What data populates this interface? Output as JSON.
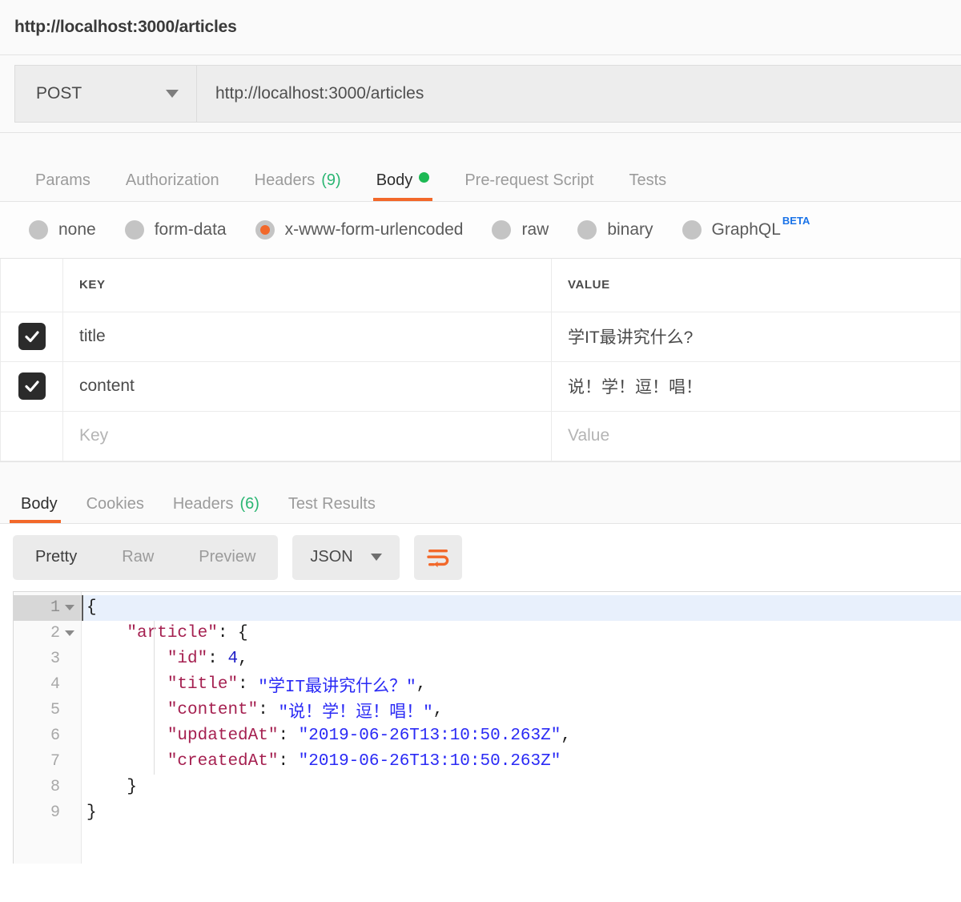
{
  "header": {
    "title": "http://localhost:3000/articles"
  },
  "request": {
    "method": "POST",
    "url": "http://localhost:3000/articles",
    "tabs": [
      {
        "label": "Params",
        "count": "",
        "active": false
      },
      {
        "label": "Authorization",
        "count": "",
        "active": false
      },
      {
        "label": "Headers",
        "count": "(9)",
        "active": false
      },
      {
        "label": "Body",
        "count": "",
        "active": true
      },
      {
        "label": "Pre-request Script",
        "count": "",
        "active": false
      },
      {
        "label": "Tests",
        "count": "",
        "active": false
      }
    ],
    "body_types": [
      {
        "label": "none",
        "checked": false
      },
      {
        "label": "form-data",
        "checked": false
      },
      {
        "label": "x-www-form-urlencoded",
        "checked": true
      },
      {
        "label": "raw",
        "checked": false
      },
      {
        "label": "binary",
        "checked": false
      },
      {
        "label": "GraphQL",
        "checked": false,
        "badge": "BETA"
      }
    ],
    "table": {
      "headers": {
        "key": "KEY",
        "value": "VALUE"
      },
      "rows": [
        {
          "checked": true,
          "key": "title",
          "value": "学IT最讲究什么?"
        },
        {
          "checked": true,
          "key": "content",
          "value": "说！学！逗！唱！"
        }
      ],
      "new_row": {
        "key_placeholder": "Key",
        "value_placeholder": "Value"
      }
    }
  },
  "response": {
    "tabs": [
      {
        "label": "Body",
        "count": "",
        "active": true
      },
      {
        "label": "Cookies",
        "count": "",
        "active": false
      },
      {
        "label": "Headers",
        "count": "(6)",
        "active": false
      },
      {
        "label": "Test Results",
        "count": "",
        "active": false
      }
    ],
    "view_modes": [
      {
        "label": "Pretty",
        "active": true
      },
      {
        "label": "Raw",
        "active": false
      },
      {
        "label": "Preview",
        "active": false
      }
    ],
    "format": "JSON",
    "wrap_icon": "word-wrap-icon",
    "code": {
      "lines": [
        {
          "num": "1",
          "fold": true,
          "highlight": true,
          "tokens": [
            {
              "t": "{",
              "c": "p"
            }
          ]
        },
        {
          "num": "2",
          "fold": true,
          "highlight": false,
          "tokens": [
            {
              "t": "    ",
              "c": "p"
            },
            {
              "t": "\"article\"",
              "c": "k"
            },
            {
              "t": ": {",
              "c": "p"
            }
          ]
        },
        {
          "num": "3",
          "fold": false,
          "highlight": false,
          "tokens": [
            {
              "t": "        ",
              "c": "p"
            },
            {
              "t": "\"id\"",
              "c": "k"
            },
            {
              "t": ": ",
              "c": "p"
            },
            {
              "t": "4",
              "c": "n"
            },
            {
              "t": ",",
              "c": "p"
            }
          ]
        },
        {
          "num": "4",
          "fold": false,
          "highlight": false,
          "tokens": [
            {
              "t": "        ",
              "c": "p"
            },
            {
              "t": "\"title\"",
              "c": "k"
            },
            {
              "t": ": ",
              "c": "p"
            },
            {
              "t": "\"学IT最讲究什么？\"",
              "c": "s"
            },
            {
              "t": ",",
              "c": "p"
            }
          ]
        },
        {
          "num": "5",
          "fold": false,
          "highlight": false,
          "tokens": [
            {
              "t": "        ",
              "c": "p"
            },
            {
              "t": "\"content\"",
              "c": "k"
            },
            {
              "t": ": ",
              "c": "p"
            },
            {
              "t": "\"说！学！逗！唱！\"",
              "c": "s"
            },
            {
              "t": ",",
              "c": "p"
            }
          ]
        },
        {
          "num": "6",
          "fold": false,
          "highlight": false,
          "tokens": [
            {
              "t": "        ",
              "c": "p"
            },
            {
              "t": "\"updatedAt\"",
              "c": "k"
            },
            {
              "t": ": ",
              "c": "p"
            },
            {
              "t": "\"2019-06-26T13:10:50.263Z\"",
              "c": "s"
            },
            {
              "t": ",",
              "c": "p"
            }
          ]
        },
        {
          "num": "7",
          "fold": false,
          "highlight": false,
          "tokens": [
            {
              "t": "        ",
              "c": "p"
            },
            {
              "t": "\"createdAt\"",
              "c": "k"
            },
            {
              "t": ": ",
              "c": "p"
            },
            {
              "t": "\"2019-06-26T13:10:50.263Z\"",
              "c": "s"
            }
          ]
        },
        {
          "num": "8",
          "fold": false,
          "highlight": false,
          "tokens": [
            {
              "t": "    }",
              "c": "p"
            }
          ]
        },
        {
          "num": "9",
          "fold": false,
          "highlight": false,
          "tokens": [
            {
              "t": "}",
              "c": "p"
            }
          ]
        }
      ]
    }
  },
  "colors": {
    "accent": "#f2682a",
    "green": "#2bb673",
    "beta_blue": "#1a73e8",
    "json_key": "#a52050",
    "json_string": "#2a2af5",
    "highlight": "#e8f0fc"
  }
}
